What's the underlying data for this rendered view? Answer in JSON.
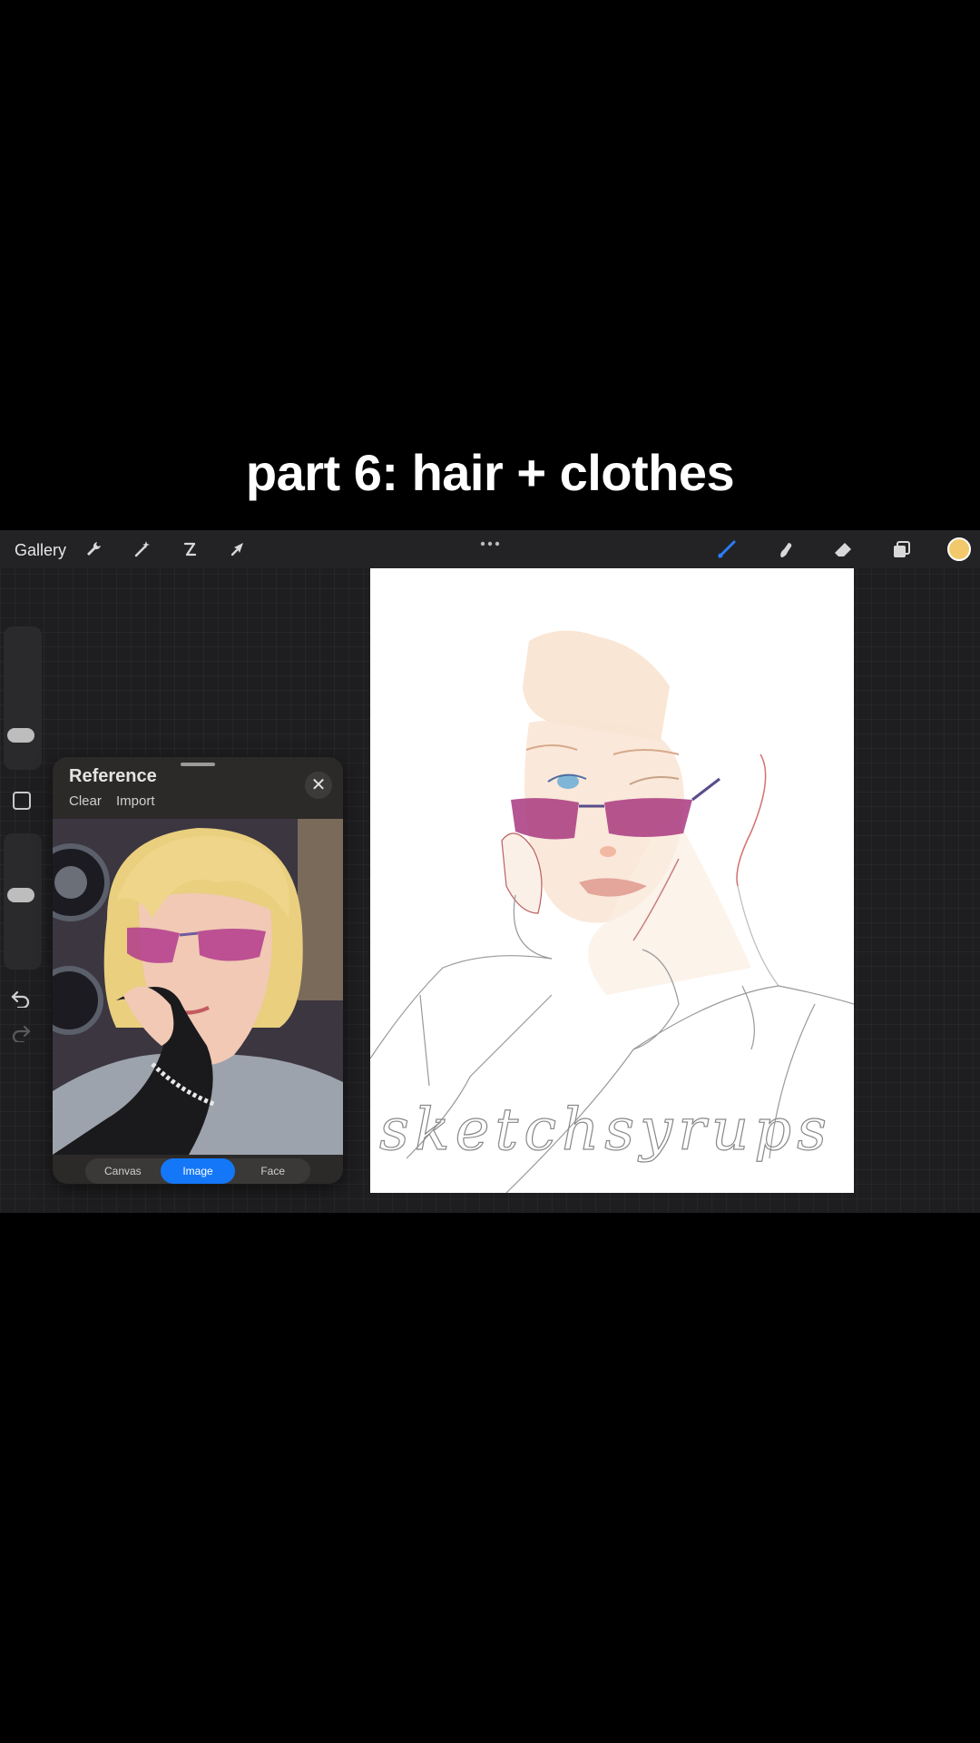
{
  "caption": "part 6: hair + clothes",
  "toolbar": {
    "gallery": "Gallery",
    "left_icons": [
      "wrench-icon",
      "magic-wand-icon",
      "selection-icon",
      "transform-arrow-icon"
    ],
    "right_icons": [
      "brush-icon",
      "smudge-icon",
      "eraser-icon",
      "layers-icon"
    ],
    "brush_active_color": "#2a7cf7",
    "current_color": "#f2c96a"
  },
  "reference": {
    "title": "Reference",
    "clear": "Clear",
    "import": "Import",
    "close": "✕",
    "tabs": [
      {
        "label": "Canvas",
        "active": false
      },
      {
        "label": "Image",
        "active": true
      },
      {
        "label": "Face",
        "active": false
      }
    ],
    "tab_active_color": "#1477f8"
  },
  "canvas": {
    "watermark": "sketchsyrups"
  }
}
